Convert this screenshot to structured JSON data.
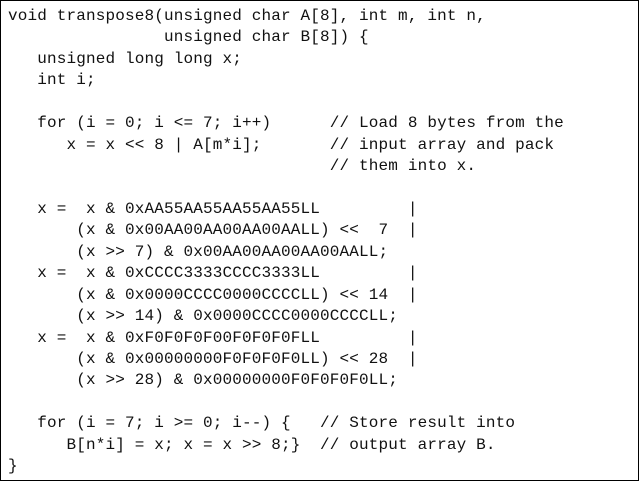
{
  "code": {
    "lines": [
      "void transpose8(unsigned char A[8], int m, int n,",
      "                unsigned char B[8]) {",
      "   unsigned long long x;",
      "   int i;",
      "",
      "   for (i = 0; i <= 7; i++)      // Load 8 bytes from the",
      "      x = x << 8 | A[m*i];       // input array and pack",
      "                                 // them into x.",
      "",
      "   x =  x & 0xAA55AA55AA55AA55LL         |",
      "       (x & 0x00AA00AA00AA00AALL) <<  7  |",
      "       (x >> 7) & 0x00AA00AA00AA00AALL;",
      "   x =  x & 0xCCCC3333CCCC3333LL         |",
      "       (x & 0x0000CCCC0000CCCCLL) << 14  |",
      "       (x >> 14) & 0x0000CCCC0000CCCCLL;",
      "   x =  x & 0xF0F0F0F00F0F0F0FLL         |",
      "       (x & 0x00000000F0F0F0F0LL) << 28  |",
      "       (x >> 28) & 0x00000000F0F0F0F0LL;",
      "",
      "   for (i = 7; i >= 0; i--) {   // Store result into",
      "      B[n*i] = x; x = x >> 8;}  // output array B.",
      "}"
    ]
  }
}
